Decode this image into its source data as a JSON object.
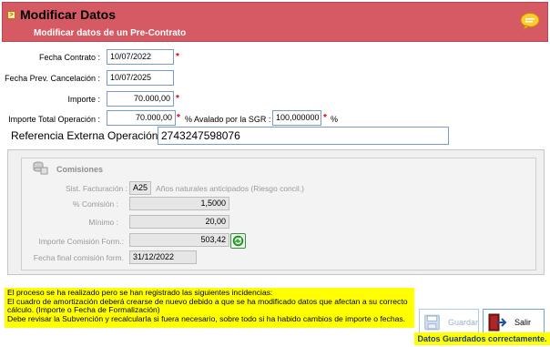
{
  "header": {
    "title": "Modificar Datos",
    "subtitle": "Modificar datos de un Pre-Contrato",
    "icon": "collapse-icon",
    "chat_icon": "speech-bubble-icon"
  },
  "form": {
    "fecha_contrato_label": "Fecha Contrato :",
    "fecha_contrato_value": "10/07/2022",
    "fecha_prev_label": "Fecha Prev. Cancelación :",
    "fecha_prev_value": "10/07/2025",
    "importe_label": "Importe :",
    "importe_value": "70.000,00",
    "importe_total_label": "Importe Total Operación :",
    "importe_total_value": "70.000,00",
    "avalado_label": "% Avalado por la SGR :",
    "avalado_value": "100,000000",
    "percent_sign": "%",
    "required_mark": "*",
    "referencia_label": "Referencia Externa Operación :",
    "referencia_value": "2743247598076"
  },
  "comisiones": {
    "title": "Comisiones",
    "sist_label": "Sist. Facturación :",
    "sist_code": "A25",
    "sist_desc": "Años naturales anticipados (Riesgo concil.)",
    "comision_label": "% Comisión :",
    "comision_value": "1,5000",
    "minimo_label": "Mínimo :",
    "minimo_value": "20,00",
    "importe_comision_label": "Importe Comisión Form.:",
    "importe_comision_value": "503,42",
    "fecha_final_label": "Fecha final comisión form.",
    "fecha_final_value": "31/12/2022"
  },
  "warning": {
    "line1": "El proceso se ha realizado pero se han registrado las siguientes incidencias:",
    "line2": "El cuadro de amortización deberá crearse de nuevo debido a que se ha modificado datos que afectan a su correcto",
    "line3": "cálculo. (Importe o Fecha de Formalización)",
    "line4": "Debe revisar la Subvención y recalcularla si fuera necesario, sobre todo si ha habido cambios de importe o fechas."
  },
  "buttons": {
    "save_label": "Guardar",
    "exit_label": "Salir"
  },
  "status": "Datos Guardados correctamente.",
  "colors": {
    "header_bg": "#d65a63",
    "warning_bg": "#ffff00",
    "required": "#e0001a",
    "status_text": "#1c3c8a"
  }
}
